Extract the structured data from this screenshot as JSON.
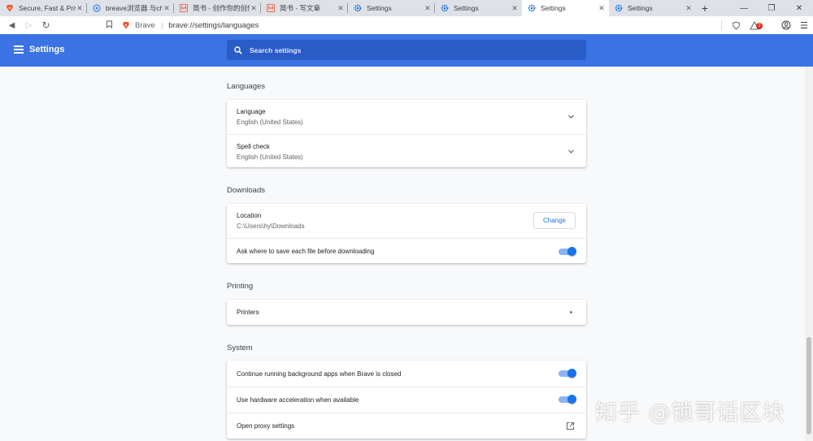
{
  "tabs": [
    {
      "title": "Secure, Fast & Priv",
      "icon": "brave-lion-icon",
      "active": false
    },
    {
      "title": "breave浏览器 与chr",
      "icon": "brave-lion-outline-icon",
      "active": false
    },
    {
      "title": "简书 - 创作你的创作",
      "icon": "jianshu-icon",
      "active": false
    },
    {
      "title": "简书 - 写文章",
      "icon": "jianshu-icon",
      "active": false
    },
    {
      "title": "Settings",
      "icon": "gear-icon",
      "active": false
    },
    {
      "title": "Settings",
      "icon": "gear-icon",
      "active": false
    },
    {
      "title": "Settings",
      "icon": "gear-icon",
      "active": true
    },
    {
      "title": "Settings",
      "icon": "gear-icon",
      "active": false
    }
  ],
  "toolbar": {
    "brand": "Brave",
    "url": "brave://settings/languages",
    "rewards_badge": "2"
  },
  "header": {
    "title": "Settings",
    "search_placeholder": "Search settings"
  },
  "sections": {
    "languages": {
      "title": "Languages",
      "language_label": "Language",
      "language_value": "English (United States)",
      "spell_label": "Spell check",
      "spell_value": "English (United States)"
    },
    "downloads": {
      "title": "Downloads",
      "location_label": "Location",
      "location_value": "C:\\Users\\hy\\Downloads",
      "change_label": "Change",
      "ask_label": "Ask where to save each file before downloading",
      "ask_enabled": true
    },
    "printing": {
      "title": "Printing",
      "printers_label": "Printers"
    },
    "system": {
      "title": "System",
      "background_label": "Continue running background apps when Brave is closed",
      "background_enabled": true,
      "hw_label": "Use hardware acceleration when available",
      "hw_enabled": true,
      "proxy_label": "Open proxy settings"
    }
  },
  "watermark": "知乎 @锁哥话区块",
  "colors": {
    "header_blue": "#3b73e5",
    "accent": "#1a73e8"
  }
}
